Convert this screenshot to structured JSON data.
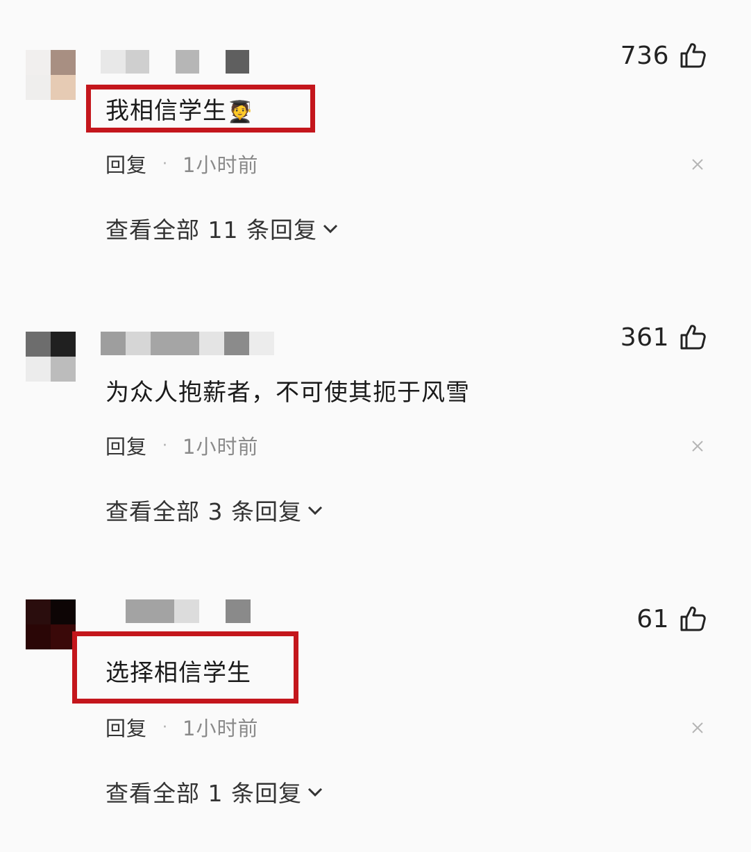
{
  "comments": [
    {
      "likes": "736",
      "text": "我相信学生",
      "text_emoji": "🧑‍🎓",
      "reply_label": "回复",
      "time": "1小时前",
      "view_replies": "查看全部 11 条回复",
      "highlighted": true
    },
    {
      "likes": "361",
      "text": "为众人抱薪者，不可使其扼于风雪",
      "text_emoji": "",
      "reply_label": "回复",
      "time": "1小时前",
      "view_replies": "查看全部 3 条回复",
      "highlighted": false
    },
    {
      "likes": "61",
      "text": "选择相信学生",
      "text_emoji": "",
      "reply_label": "回复",
      "time": "1小时前",
      "view_replies": "查看全部 1 条回复",
      "highlighted": true
    }
  ],
  "icons": {
    "like": "thumbs-up-icon",
    "close": "close-icon",
    "expand": "chevron-down-icon"
  },
  "colors": {
    "highlight_border": "#c4161c",
    "time_text": "#8a8a8a",
    "background": "#fafafa"
  }
}
